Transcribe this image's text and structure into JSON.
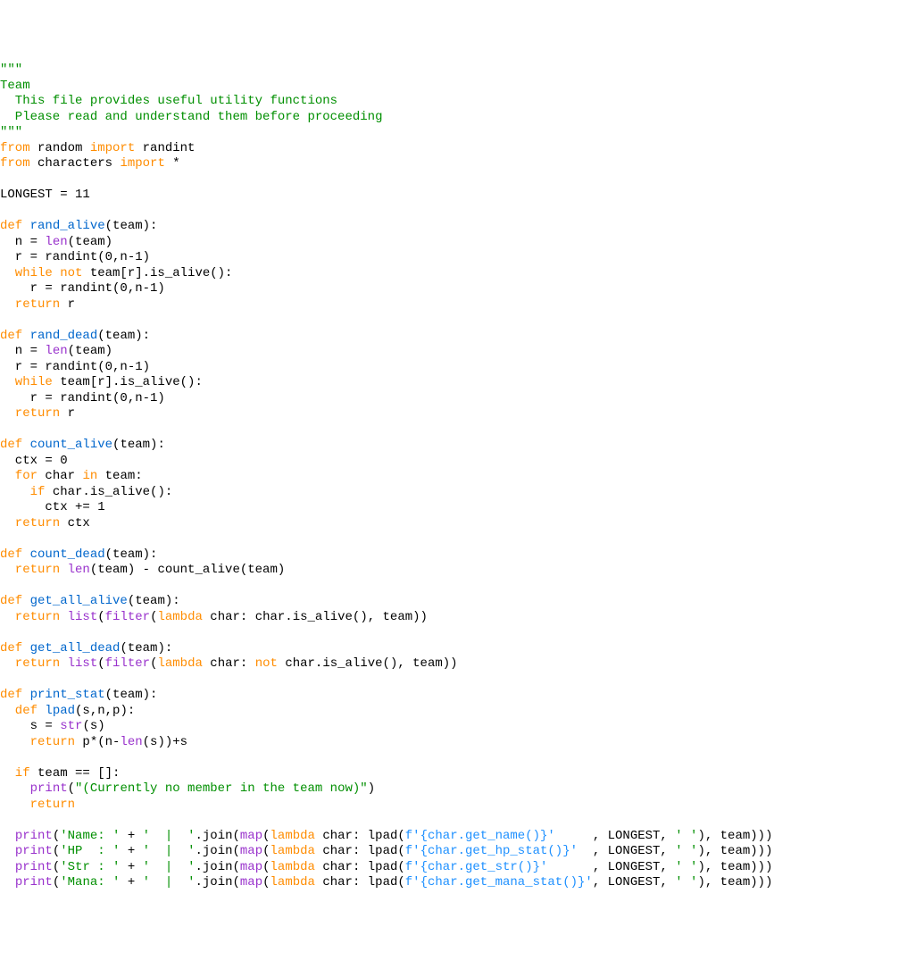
{
  "code": {
    "docstring_delim": "\"\"\"",
    "doc1": "Team",
    "doc2": "  This file provides useful utility functions",
    "doc3": "  Please read and understand them before proceeding",
    "from1": "from",
    "random": " random ",
    "import1": "import",
    "randint_name": " randint",
    "from2": "from",
    "characters": " characters ",
    "import2": "import",
    "star": " *",
    "longest": "LONGEST = 11",
    "def1": "def",
    "rand_alive": " rand_alive",
    "rand_alive_sig": "(team):",
    "n_len": "  n = ",
    "len_kw": "len",
    "n_len_arg": "(team)",
    "r_randint1": "  r = randint(0,n-1)",
    "while1": "  while",
    "not1": " not",
    "while_cond1": " team[r].is_alive():",
    "r_randint2": "    r = randint(0,n-1)",
    "return1": "  return",
    "return_r1": " r",
    "def2": "def",
    "rand_dead": " rand_dead",
    "rand_dead_sig": "(team):",
    "r_randint3": "  r = randint(0,n-1)",
    "while2": "  while",
    "while_cond2": " team[r].is_alive():",
    "r_randint4": "    r = randint(0,n-1)",
    "return2": "  return",
    "return_r2": " r",
    "def3": "def",
    "count_alive": " count_alive",
    "count_alive_sig": "(team):",
    "ctx0": "  ctx = 0",
    "for1": "  for",
    "char1": " char ",
    "in1": "in",
    "team1": " team:",
    "if1": "    if",
    "if_cond1": " char.is_alive():",
    "ctx_inc": "      ctx += 1",
    "return3": "  return",
    "return_ctx": " ctx",
    "def4": "def",
    "count_dead": " count_dead",
    "count_dead_sig": "(team):",
    "return4": "  return",
    "len2": " len",
    "count_dead_body": "(team) - count_alive(team)",
    "def5": "def",
    "get_all_alive": " get_all_alive",
    "get_all_alive_sig": "(team):",
    "return5": "  return",
    "list1": " list",
    "filter1_open": "(",
    "filter1": "filter",
    "filter1_arg_open": "(",
    "lambda1": "lambda",
    "lambda1_body": " char: char.is_alive(), team))",
    "def6": "def",
    "get_all_dead": " get_all_dead",
    "get_all_dead_sig": "(team):",
    "return6": "  return",
    "list2": " list",
    "filter2_open": "(",
    "filter2": "filter",
    "filter2_arg_open": "(",
    "lambda2": "lambda",
    "lambda2_char": " char: ",
    "not2": "not",
    "lambda2_body": " char.is_alive(), team))",
    "def7": "def",
    "print_stat": " print_stat",
    "print_stat_sig": "(team):",
    "def8": "  def",
    "lpad": " lpad",
    "lpad_sig": "(s,n,p):",
    "s_str_indent": "    s = ",
    "str_kw": "str",
    "s_str_arg": "(s)",
    "return7": "    return",
    "lpad_body_1": " p*(n-",
    "len3": "len",
    "lpad_body_2": "(s))+s",
    "if2": "  if",
    "if_cond2": " team == []:",
    "print1_indent": "    ",
    "print_kw1": "print",
    "print1_open": "(",
    "print1_str": "\"(Currently no member in the team now)\"",
    "print1_close": ")",
    "return8": "    return",
    "print2_indent": "  ",
    "print_kw2": "print",
    "print2_open": "(",
    "print2_str1": "'Name: '",
    "plus": " + ",
    "print2_str2": "'  |  '",
    "join1": ".join(",
    "map1": "map",
    "map1_open": "(",
    "lambda3": "lambda",
    "lambda3_body": " char: lpad(",
    "fstr1": "f'{char.get_name()}'",
    "print2_tail": "     , LONGEST, ",
    "space_str": "' '",
    "print2_close": "), team)))",
    "print_kw3": "print",
    "print3_str1": "'HP  : '",
    "print3_str2": "'  |  '",
    "fstr2": "f'{char.get_hp_stat()}'",
    "print3_tail": "  , LONGEST, ",
    "print_kw4": "print",
    "print4_str1": "'Str : '",
    "print4_str2": "'  |  '",
    "fstr3": "f'{char.get_str()}'",
    "print4_tail": "      , LONGEST, ",
    "print_kw5": "print",
    "print5_str1": "'Mana: '",
    "print5_str2": "'  |  '",
    "fstr4": "f'{char.get_mana_stat()}'",
    "print5_tail": ", LONGEST, "
  }
}
